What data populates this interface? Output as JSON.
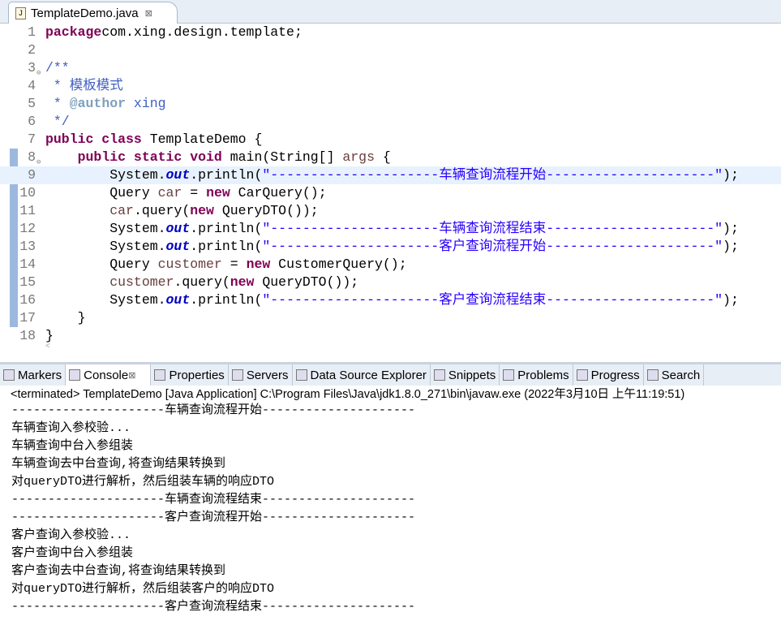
{
  "editor": {
    "tab_label": "TemplateDemo.java",
    "close": "⊠",
    "lines": [
      [
        [
          "kw",
          "package"
        ],
        [
          "",
          "com.xing.design.template;"
        ]
      ],
      [],
      [
        [
          "cm",
          "/**"
        ]
      ],
      [
        [
          "cm",
          " * 模板模式"
        ]
      ],
      [
        [
          "cm",
          " * "
        ],
        [
          "tag",
          "@author"
        ],
        [
          "cm",
          " xing"
        ]
      ],
      [
        [
          "cm",
          " */"
        ]
      ],
      [
        [
          "kw",
          "public class"
        ],
        [
          "",
          " TemplateDemo {"
        ]
      ],
      [
        [
          "",
          "    "
        ],
        [
          "kw",
          "public static void"
        ],
        [
          "",
          " main(String[] "
        ],
        [
          "vr",
          "args"
        ],
        [
          "",
          " {"
        ]
      ],
      [
        [
          "",
          "        System."
        ],
        [
          "fd",
          "out"
        ],
        [
          "",
          ".println("
        ],
        [
          "st",
          "\"---------------------车辆查询流程开始---------------------\""
        ],
        [
          "",
          ");"
        ]
      ],
      [
        [
          "",
          "        Query "
        ],
        [
          "vr",
          "car"
        ],
        [
          "",
          " = "
        ],
        [
          "kw",
          "new"
        ],
        [
          "",
          " CarQuery();"
        ]
      ],
      [
        [
          "",
          "        "
        ],
        [
          "vr",
          "car"
        ],
        [
          "",
          ".query("
        ],
        [
          "kw",
          "new"
        ],
        [
          "",
          " QueryDTO());"
        ]
      ],
      [
        [
          "",
          "        System."
        ],
        [
          "fd",
          "out"
        ],
        [
          "",
          ".println("
        ],
        [
          "st",
          "\"---------------------车辆查询流程结束---------------------\""
        ],
        [
          "",
          ");"
        ]
      ],
      [
        [
          "",
          "        System."
        ],
        [
          "fd",
          "out"
        ],
        [
          "",
          ".println("
        ],
        [
          "st",
          "\"---------------------客户查询流程开始---------------------\""
        ],
        [
          "",
          ");"
        ]
      ],
      [
        [
          "",
          "        Query "
        ],
        [
          "vr",
          "customer"
        ],
        [
          "",
          " = "
        ],
        [
          "kw",
          "new"
        ],
        [
          "",
          " CustomerQuery();"
        ]
      ],
      [
        [
          "",
          "        "
        ],
        [
          "vr",
          "customer"
        ],
        [
          "",
          ".query("
        ],
        [
          "kw",
          "new"
        ],
        [
          "",
          " QueryDTO());"
        ]
      ],
      [
        [
          "",
          "        System."
        ],
        [
          "fd",
          "out"
        ],
        [
          "",
          ".println("
        ],
        [
          "st",
          "\"---------------------客户查询流程结束---------------------\""
        ],
        [
          "",
          ");"
        ]
      ],
      [
        [
          "",
          "    }"
        ]
      ],
      [
        [
          "",
          "}"
        ]
      ]
    ]
  },
  "panel": {
    "tabs": [
      "Markers",
      "Console",
      "Properties",
      "Servers",
      "Data Source Explorer",
      "Snippets",
      "Problems",
      "Progress",
      "Search"
    ],
    "status": "<terminated> TemplateDemo [Java Application] C:\\Program Files\\Java\\jdk1.8.0_271\\bin\\javaw.exe (2022年3月10日 上午11:19:51)",
    "output": [
      "---------------------车辆查询流程开始---------------------",
      "车辆查询入参校验...",
      "车辆查询中台入参组装",
      "车辆查询去中台查询,将查询结果转换到",
      "对queryDTO进行解析，然后组装车辆的响应DTO",
      "---------------------车辆查询流程结束---------------------",
      "---------------------客户查询流程开始---------------------",
      "客户查询入参校验...",
      "客户查询中台入参组装",
      "客户查询去中台查询,将查询结果转换到",
      "对queryDTO进行解析，然后组装客户的响应DTO",
      "---------------------客户查询流程结束---------------------"
    ]
  }
}
